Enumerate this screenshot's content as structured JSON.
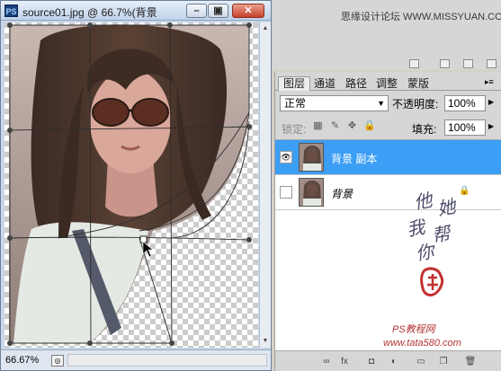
{
  "window": {
    "title": "source01.jpg @ 66.7%(背景",
    "app_icon": "PS",
    "buttons": [
      "minimize",
      "restore",
      "close"
    ]
  },
  "status": {
    "zoom": "66.67%"
  },
  "watermark_top": "思缘设计论坛 WWW.MISSYUAN.COM",
  "panel": {
    "tabs": [
      "图层",
      "通道",
      "路径",
      "调整",
      "蒙版"
    ],
    "active_tab": "图层",
    "blend_mode": "正常",
    "opacity_label": "不透明度:",
    "opacity_value": "100%",
    "lock_label": "锁定:",
    "fill_label": "填充:",
    "fill_value": "100%",
    "layers": [
      {
        "name": "背景 副本",
        "selected": true,
        "visible": true
      },
      {
        "name": "背景",
        "selected": false,
        "visible": false,
        "locked": true
      }
    ]
  },
  "signature": {
    "chars": [
      "他",
      "她",
      "我",
      "帮",
      "你"
    ],
    "site": "PS教程网",
    "url": "www.tata580.com"
  },
  "colors": {
    "selection": "#3c9ef5",
    "panel_bg": "#d6d6d6",
    "title_bg": "#c1d3ea"
  }
}
